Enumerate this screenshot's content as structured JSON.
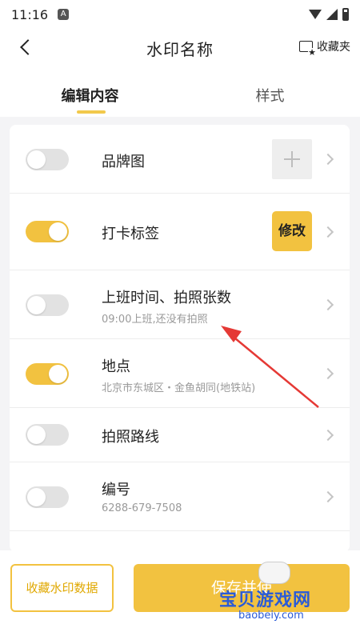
{
  "status_bar": {
    "time": "11:16",
    "notification_glyph": "A",
    "icons": [
      "wifi-icon",
      "signal-icon",
      "battery-icon"
    ]
  },
  "header": {
    "title": "水印名称",
    "favorites_label": "收藏夹"
  },
  "tabs": [
    {
      "label": "编辑内容",
      "active": true
    },
    {
      "label": "样式",
      "active": false
    }
  ],
  "rows": [
    {
      "label": "品牌图",
      "sub": "",
      "toggle_on": false,
      "action": "add"
    },
    {
      "label": "打卡标签",
      "sub": "",
      "toggle_on": true,
      "action": "edit",
      "action_label": "修改"
    },
    {
      "label": "上班时间、拍照张数",
      "sub": "09:00上班,还没有拍照",
      "toggle_on": false
    },
    {
      "label": "地点",
      "sub": "北京市东城区・金鱼胡同(地铁站)",
      "toggle_on": true
    },
    {
      "label": "拍照路线",
      "sub": "",
      "toggle_on": false
    },
    {
      "label": "编号",
      "sub": "6288-679-7508",
      "toggle_on": false
    }
  ],
  "bottom": {
    "fav_data_label": "收藏水印数据",
    "save_label": "保存并使"
  },
  "watermark": {
    "text": "宝贝游戏网",
    "url": "baobeiy.com"
  },
  "colors": {
    "accent": "#f2c240",
    "accent_text": "#e0a800",
    "arrow": "#e53935"
  }
}
